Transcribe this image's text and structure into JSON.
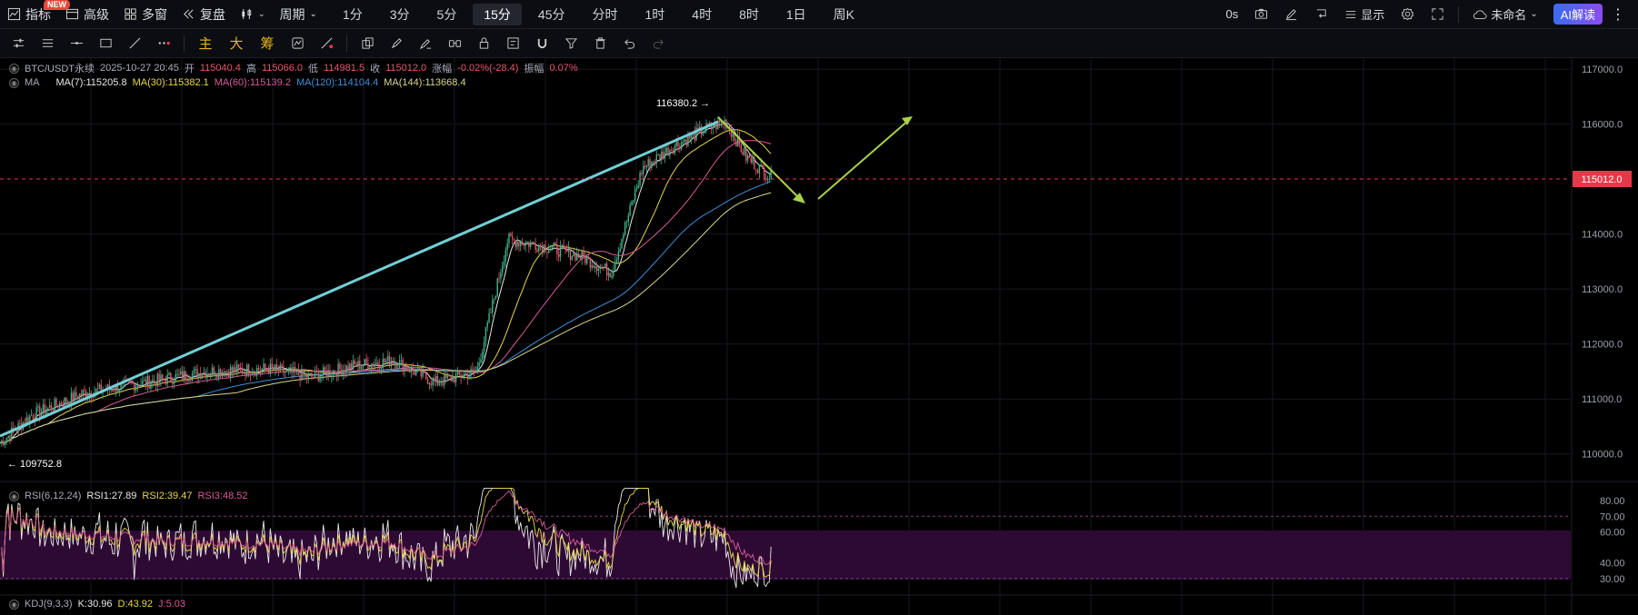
{
  "topbar": {
    "indicator_label": "指标",
    "new_badge": "NEW",
    "advanced_label": "高级",
    "multiwindow_label": "多窗",
    "replay_label": "复盘",
    "period_label": "周期",
    "intervals": [
      "1分",
      "3分",
      "5分",
      "15分",
      "45分",
      "分时",
      "1时",
      "4时",
      "8时",
      "1日",
      "周K"
    ],
    "active_interval": "15分",
    "countdown": "0s",
    "display_label": "显示",
    "layout_name": "未命名",
    "ai_label": "AI解读"
  },
  "toolbar": {
    "main_label": "主",
    "big_label": "大",
    "chip_label": "筹"
  },
  "info": {
    "symbol": "BTC/USDT永续",
    "datetime": "2025-10-27 20:45",
    "open_label": "开",
    "open": "115040.4",
    "high_label": "高",
    "high": "115066.0",
    "low_label": "低",
    "low": "114981.5",
    "close_label": "收",
    "close": "115012.0",
    "change_label": "涨幅",
    "change": "-0.02%(-28.4)",
    "amp_label": "振幅",
    "amp": "0.07%"
  },
  "ma_legend": {
    "title": "MA",
    "ma7": "MA(7):115205.8",
    "ma30": "MA(30):115382.1",
    "ma60": "MA(60):115139.2",
    "ma120": "MA(120):114104.4",
    "ma144": "MA(144):113668.4"
  },
  "rsi_legend": {
    "title": "RSI(6,12,24)",
    "rsi1": "RSI1:27.89",
    "rsi2": "RSI2:39.47",
    "rsi3": "RSI3:48.52"
  },
  "kdj_legend": {
    "title": "KDJ(9,3,3)",
    "k": "K:30.96",
    "d": "D:43.92",
    "j": "J:5.03"
  },
  "price_axis": [
    "117000.0",
    "116000.0",
    "114000.0",
    "113000.0",
    "112000.0",
    "111000.0",
    "110000.0"
  ],
  "current_price": "115012.0",
  "rsi_axis": [
    "80.00",
    "70.00",
    "60.00",
    "40.00",
    "30.00"
  ],
  "annotations": {
    "high_mark": "116380.2 →",
    "low_mark": "← 109752.8"
  },
  "colors": {
    "up": "#3fb38a",
    "down": "#e5556b",
    "ma7": "#e8e8e8",
    "ma30": "#e6d64a",
    "ma60": "#d85a9a",
    "ma120": "#3b8fd9",
    "ma144": "#d9d68a",
    "trend": "#70d0d6",
    "arrow": "#a8d24a",
    "current": "#e5394a"
  },
  "chart_data": {
    "type": "candlestick",
    "price_range": [
      109500,
      117200
    ],
    "rsi_range": [
      20,
      90
    ],
    "waypoints_x": [
      0,
      30,
      80,
      140,
      200,
      260,
      300,
      340,
      380,
      420,
      460,
      490,
      520,
      560,
      590,
      620,
      650,
      680,
      700,
      720,
      745
    ],
    "waypoints_close": [
      110200,
      110700,
      111100,
      111300,
      111500,
      111550,
      111400,
      111600,
      111700,
      111300,
      111500,
      113900,
      113800,
      113600,
      113300,
      115200,
      115600,
      115900,
      116050,
      115400,
      115012
    ]
  }
}
